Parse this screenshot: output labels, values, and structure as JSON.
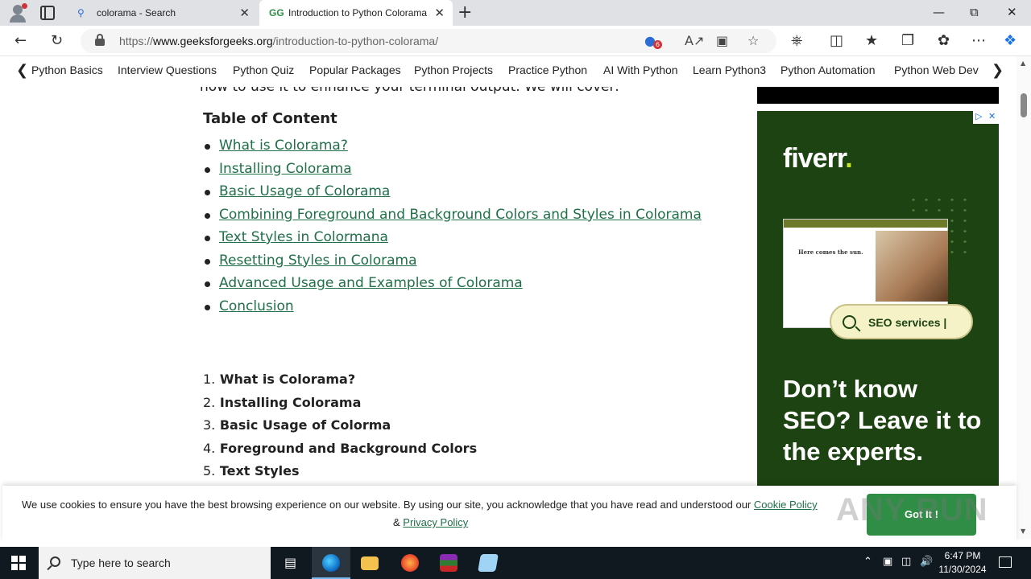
{
  "browser": {
    "tabs": [
      {
        "title": "colorama - Search",
        "favicon": "search-icon"
      },
      {
        "title": "Introduction to Python Colorama",
        "favicon": "geeksforgeeks-logo"
      }
    ],
    "url_prefix": "https://",
    "url_domain": "www.geeksforgeeks.org",
    "url_path": "/introduction-to-python-colorama/",
    "shopping_badge_count": "6"
  },
  "sitenav": {
    "items": [
      "Python Basics",
      "Interview Questions",
      "Python Quiz",
      "Popular Packages",
      "Python Projects",
      "Practice Python",
      "AI With Python",
      "Learn Python3",
      "Python Automation",
      "Python Web Dev"
    ]
  },
  "article": {
    "cut_line": "how to use it to enhance your terminal output. We will cover:",
    "toc_title": "Table of Content",
    "toc": [
      "What is Colorama?",
      "Installing Colorama",
      "Basic Usage of Colorama",
      "Combining Foreground and Background Colors and Styles in Colorama",
      "Text Styles in Colormana",
      "Resetting Styles in Colorama",
      "Advanced Usage and Examples of Colorama",
      "Conclusion"
    ],
    "numbered": [
      {
        "n": "1.",
        "text": "What is Colorama?"
      },
      {
        "n": "2.",
        "text": "Installing Colorama"
      },
      {
        "n": "3.",
        "text": "Basic Usage of Colorma"
      },
      {
        "n": "4.",
        "text": "Foreground and Background Colors"
      },
      {
        "n": "5.",
        "text": "Text Styles"
      }
    ]
  },
  "ad": {
    "brand": "fiverr",
    "mock_title": "Here comes the sun.",
    "search_text": "SEO services |",
    "headline": "Don’t know SEO? Leave it to the experts."
  },
  "cookie": {
    "message": "We use cookies to ensure you have the best browsing experience on our website. By using our site, you acknowledge that you have read and understood our",
    "cookie_policy": "Cookie Policy",
    "amp": "&",
    "privacy_policy": "Privacy Policy",
    "button": "Got It !",
    "watermark": "ANY RUN"
  },
  "taskbar": {
    "search_placeholder": "Type here to search",
    "time": "6:47 PM",
    "date": "11/30/2024"
  }
}
